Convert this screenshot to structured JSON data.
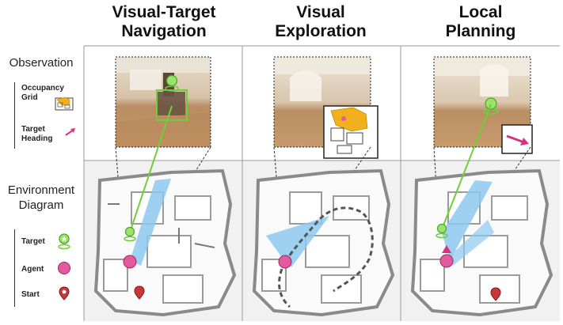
{
  "columns": [
    {
      "title_line1": "Visual-Target",
      "title_line2": "Navigation"
    },
    {
      "title_line1": "Visual",
      "title_line2": "Exploration"
    },
    {
      "title_line1": "Local",
      "title_line2": "Planning"
    }
  ],
  "rows": {
    "observation_label": "Observation",
    "environment_label_line1": "Environment",
    "environment_label_line2": "Diagram"
  },
  "observation_legend": {
    "occupancy_line1": "Occupancy",
    "occupancy_line2": "Grid",
    "heading_line1": "Target",
    "heading_line2": "Heading"
  },
  "environment_legend": {
    "target": "Target",
    "agent": "Agent",
    "start": "Start"
  },
  "colors": {
    "target_green": "#6fcf3a",
    "agent_pink": "#e35aa0",
    "start_red": "#b52a2a",
    "fov_blue": "#8cc8ee",
    "heading_arrow": "#d6337f"
  }
}
